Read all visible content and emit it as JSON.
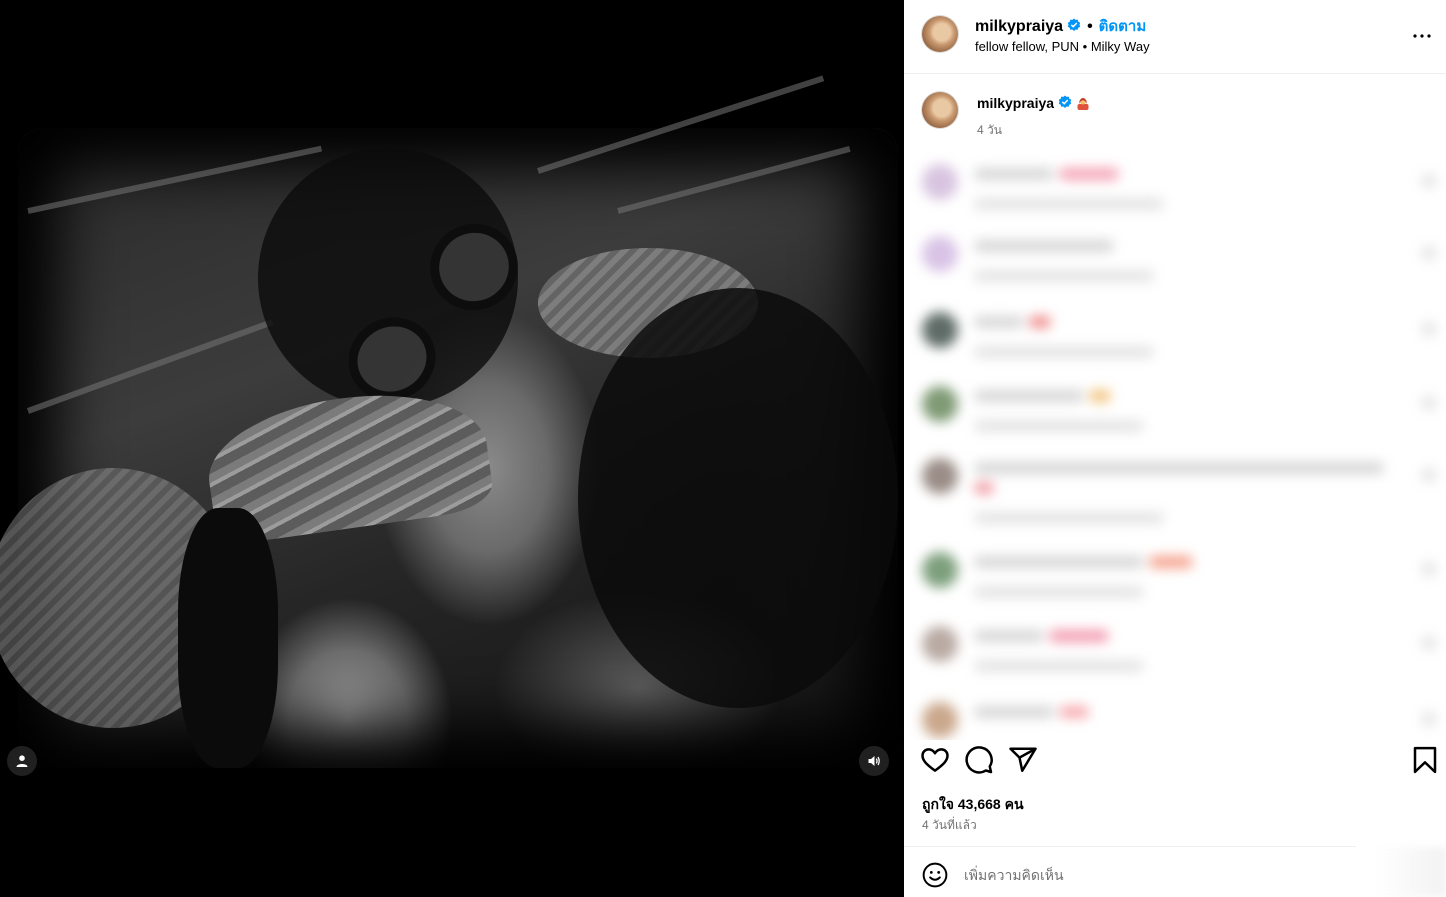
{
  "post": {
    "username": "milkypraiya",
    "verified": true,
    "follow_label": "ติดตาม",
    "header_dot": "•",
    "audio_text": "fellow fellow, PUN",
    "location": "Milky Way",
    "meta_separator": " • ",
    "caption_time": "4 วัน",
    "likes_text": "ถูกใจ 43,668 คน",
    "date_text": "4 วันที่แล้ว",
    "comment_placeholder": "เพิ่มความคิดเห็น"
  },
  "colors": {
    "accent": "#0095f6",
    "verified": "#0095f6",
    "muted_text": "#737373",
    "divider": "#efefef"
  },
  "icons": {
    "more": "more-horizontal-icon",
    "like": "heart-icon",
    "comment": "speech-bubble-icon",
    "share": "paper-plane-icon",
    "save": "bookmark-icon",
    "emoji": "smiley-icon",
    "user_tags": "user-tag-icon",
    "sound": "speaker-icon"
  },
  "comments_blurred": [
    {
      "avatar_color": "#d8c4e0",
      "accent": "#f4a3b5"
    },
    {
      "avatar_color": "#d9c3e6",
      "accent": ""
    },
    {
      "avatar_color": "#5e6b67",
      "accent": "#ef8a8a"
    },
    {
      "avatar_color": "#7f9a74",
      "accent": "#f1c27a"
    },
    {
      "avatar_color": "#9a8c86",
      "accent": "#f19aa4"
    },
    {
      "avatar_color": "#7d9f7c",
      "accent": "#f5a08a"
    },
    {
      "avatar_color": "#b9aaa3",
      "accent": "#f39ab0"
    },
    {
      "avatar_color": "#caa88c",
      "accent": "#f6a9ae"
    }
  ]
}
